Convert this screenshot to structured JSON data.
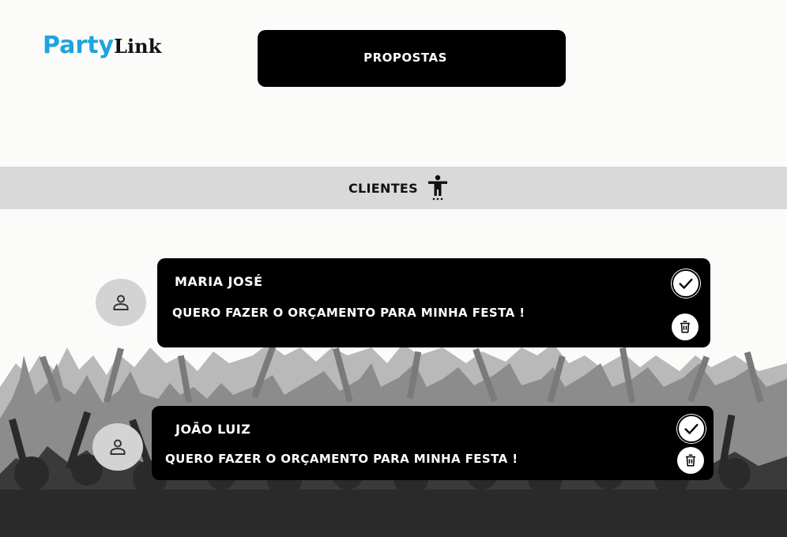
{
  "logo": {
    "part1": "Party",
    "part2": "Link"
  },
  "nav": {
    "propostas_label": "PROPOSTAS"
  },
  "section": {
    "title": "CLIENTES",
    "icon": "accessibility-person-icon"
  },
  "proposals": [
    {
      "name": "MARIA JOSÉ",
      "message": "QUERO FAZER O ORÇAMENTO PARA MINHA FESTA !",
      "avatar_icon": "person-icon",
      "accept_icon": "check-icon",
      "delete_icon": "trash-icon"
    },
    {
      "name": "JOÃO LUIZ",
      "message": "QUERO FAZER O ORÇAMENTO PARA MINHA FESTA !",
      "avatar_icon": "person-icon",
      "accept_icon": "check-icon",
      "delete_icon": "trash-icon"
    }
  ],
  "colors": {
    "brand_blue": "#1ea3dd",
    "card_bg": "#000000",
    "section_bar": "#d9d9d9",
    "avatar_bg": "#d3d3d3"
  }
}
